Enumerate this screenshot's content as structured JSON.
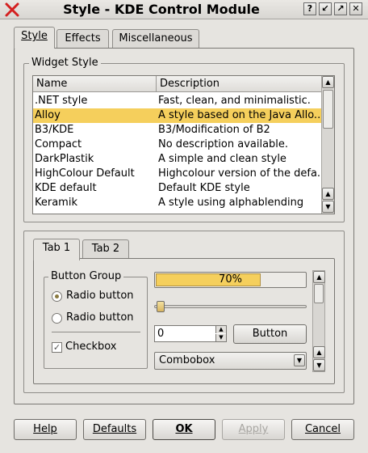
{
  "window": {
    "title": "Style - KDE Control Module",
    "buttons": [
      "?",
      "↙",
      "↗",
      "✕"
    ]
  },
  "tabs": [
    {
      "label": "Style",
      "active": true
    },
    {
      "label": "Effects",
      "active": false
    },
    {
      "label": "Miscellaneous",
      "active": false
    }
  ],
  "widget_style": {
    "legend": "Widget Style",
    "columns": [
      "Name",
      "Description"
    ],
    "rows": [
      {
        "name": ".NET style",
        "desc": "Fast, clean, and minimalistic."
      },
      {
        "name": "Alloy",
        "desc": "A style based on the Java Allo...",
        "selected": true
      },
      {
        "name": "B3/KDE",
        "desc": "B3/Modification of B2"
      },
      {
        "name": "Compact",
        "desc": "No description available."
      },
      {
        "name": "DarkPlastik",
        "desc": "A simple and clean style"
      },
      {
        "name": "HighColour Default",
        "desc": "Highcolour version of the defa..."
      },
      {
        "name": "KDE default",
        "desc": "Default KDE style"
      },
      {
        "name": "Keramik",
        "desc": "A style using alphablending"
      }
    ]
  },
  "preview": {
    "tabs": [
      "Tab 1",
      "Tab 2"
    ],
    "button_group": {
      "legend": "Button Group",
      "radio1": "Radio button",
      "radio2": "Radio button",
      "checkbox": "Checkbox"
    },
    "progress": {
      "text": "70%",
      "value": 0.7
    },
    "slider_value": 0.0,
    "spin_value": "0",
    "button": "Button",
    "combobox": "Combobox"
  },
  "footer": {
    "help": "Help",
    "defaults": "Defaults",
    "ok": "OK",
    "apply": "Apply",
    "cancel": "Cancel"
  },
  "colors": {
    "selection": "#f5cf5c",
    "close_icon": "#d42020"
  }
}
